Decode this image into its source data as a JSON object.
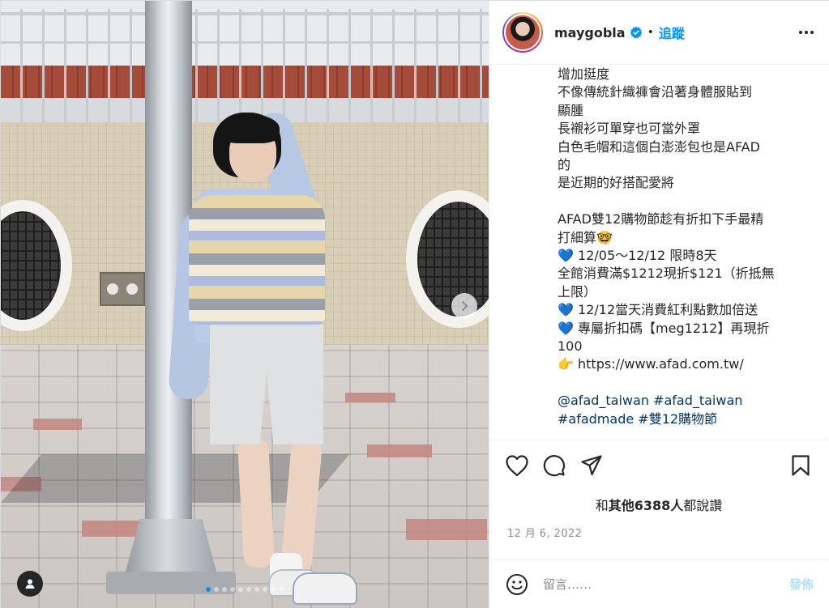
{
  "post": {
    "username": "maygobla",
    "separator": "•",
    "follow_label": "追蹤",
    "icons": {
      "verified": "verified-badge-icon",
      "more": "more-options-icon",
      "next": "chevron-right-icon",
      "tag": "user-tag-icon",
      "like": "heart-icon",
      "comment": "comment-bubble-icon",
      "share": "paper-plane-icon",
      "save": "bookmark-icon",
      "emoji": "smiley-face-icon"
    },
    "colors": {
      "accent": "#0095f6",
      "verified": "#0095f6",
      "tags": "#00376b",
      "muted": "#8e8e8e"
    },
    "carousel": {
      "total_dots": 10,
      "active_index": 0
    }
  },
  "caption": {
    "lines": [
      "增加挺度",
      "不像傳統針織褲會沿著身體服貼到",
      "顯腫",
      "長襯衫可單穿也可當外罩",
      "白色毛帽和這個白澎澎包也是AFAD",
      "的",
      "是近期的好搭配愛將"
    ],
    "promo_lines": [
      "AFAD雙12購物節趁有折扣下手最精",
      "打細算🤓",
      "💙 12/05～12/12 限時8天",
      "全館消費滿$1212現折$121（折抵無",
      "上限）",
      "💙 12/12當天消費紅利點數加倍送",
      "💙 專屬折扣碼【meg1212】再現折",
      "100",
      "👉 https://www.afad.com.tw/"
    ],
    "tag_lines": [
      "@afad_taiwan #afad_taiwan",
      "#afadmade #雙12購物節"
    ]
  },
  "engagement": {
    "likes_prefix": "和",
    "likes_bold": "其他6388人",
    "likes_suffix": "都說讚",
    "date": "12 月 6, 2022"
  },
  "comment": {
    "placeholder": "留言……",
    "post_label": "發佈"
  }
}
